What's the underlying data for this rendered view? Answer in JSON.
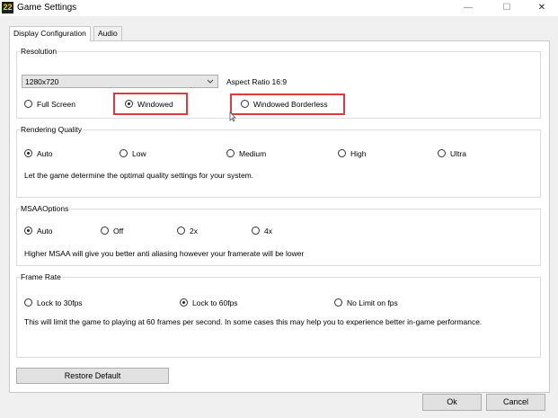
{
  "app": {
    "icon_text": "22",
    "title": "Game Settings",
    "minimize": "—",
    "maximize": "☐",
    "close": "✕"
  },
  "tabs": [
    "Display Configuration",
    "Audio"
  ],
  "resolution": {
    "label": "Resolution",
    "selected": "1280x720",
    "aspect": "Aspect Ratio 16:9",
    "modes": [
      {
        "label": "Full Screen",
        "checked": false
      },
      {
        "label": "Windowed",
        "checked": true
      },
      {
        "label": "Windowed Borderless",
        "checked": false
      }
    ]
  },
  "rendering": {
    "label": "Rendering Quality",
    "options": [
      {
        "label": "Auto",
        "checked": true
      },
      {
        "label": "Low",
        "checked": false
      },
      {
        "label": "Medium",
        "checked": false
      },
      {
        "label": "High",
        "checked": false
      },
      {
        "label": "Ultra",
        "checked": false
      }
    ],
    "description": "Let the game determine the optimal quality settings for your system."
  },
  "msaa": {
    "label": "MSAAOptions",
    "options": [
      {
        "label": "Auto",
        "checked": true
      },
      {
        "label": "Off",
        "checked": false
      },
      {
        "label": "2x",
        "checked": false
      },
      {
        "label": "4x",
        "checked": false
      }
    ],
    "description": "Higher MSAA will give you better anti aliasing however your framerate will be lower"
  },
  "framerate": {
    "label": "Frame Rate",
    "options": [
      {
        "label": "Lock  to 30fps",
        "checked": false
      },
      {
        "label": "Lock to 60fps",
        "checked": true
      },
      {
        "label": "No Limit on fps",
        "checked": false
      }
    ],
    "description": "This will limit the game to playing at 60 frames per second. In some cases this may help you to experience better in-game performance."
  },
  "buttons": {
    "restore": "Restore Default",
    "ok": "Ok",
    "cancel": "Cancel"
  },
  "colors": {
    "highlight": "#e0393b",
    "window_bg": "#f0f0f0",
    "panel_bg": "#ffffff"
  }
}
